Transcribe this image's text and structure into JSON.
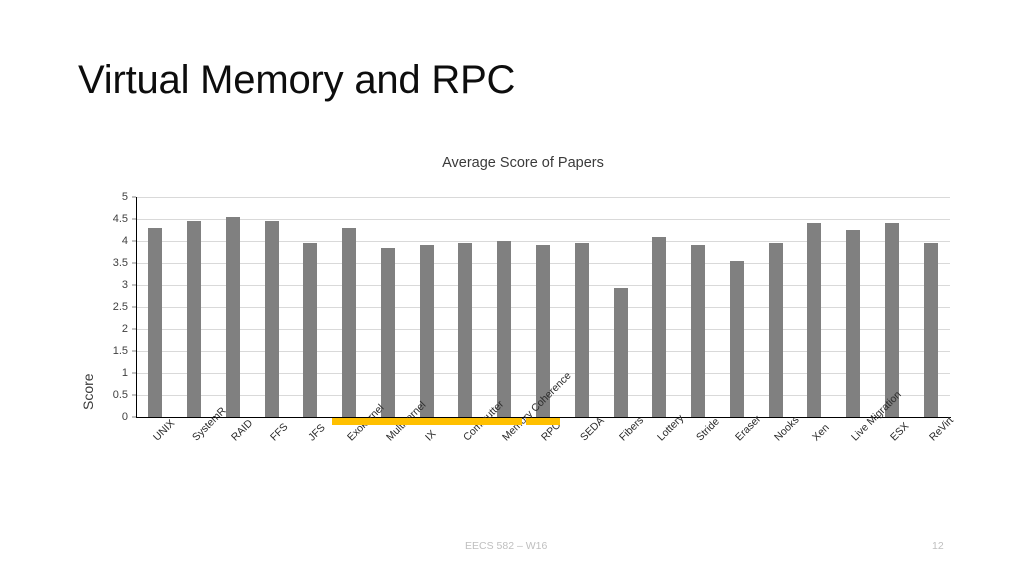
{
  "slide": {
    "title": "Virtual Memory and RPC",
    "footer_text": "EECS 582 – W16",
    "page_number": "12"
  },
  "colors": {
    "bar": "#808080",
    "highlight": "#ffc000",
    "gridline": "#d9d9d9",
    "axis": "#000000",
    "title_text": "#0d0d0d",
    "footer_text": "#bfbfbf"
  },
  "chart_data": {
    "type": "bar",
    "title": "Average Score of Papers",
    "xlabel": "",
    "ylabel": "Score",
    "ylim": [
      0,
      5
    ],
    "ytick_labels": [
      "5",
      "4.5",
      "4",
      "3.5",
      "3",
      "2.5",
      "2",
      "1.5",
      "1",
      "0.5",
      "0"
    ],
    "ytick_values": [
      5,
      4.5,
      4,
      3.5,
      3,
      2.5,
      2,
      1.5,
      1,
      0.5,
      0
    ],
    "grid": true,
    "legend": "none",
    "categories": [
      "UNIX",
      "SystemR",
      "RAID",
      "FFS",
      "JFS",
      "Exokernel",
      "Multikernel",
      "IX",
      "Commutter",
      "Memory Coherence",
      "RPC",
      "SEDA",
      "Fibers",
      "Lottery",
      "Stride",
      "Eraser",
      "Nooks",
      "Xen",
      "Live Migration",
      "ESX",
      "ReVirt"
    ],
    "values": [
      4.3,
      4.45,
      4.55,
      4.45,
      3.95,
      4.3,
      3.85,
      3.9,
      3.95,
      4.0,
      3.9,
      3.95,
      2.93,
      4.1,
      3.9,
      3.55,
      3.95,
      4.4,
      4.25,
      4.4,
      3.95
    ],
    "highlight_groups": [
      {
        "start_index": 5,
        "end_index": 9,
        "label": "virtual-memory-group"
      },
      {
        "start_index": 10,
        "end_index": 10,
        "label": "rpc-group"
      }
    ],
    "highlight_color": "#ffc000"
  }
}
